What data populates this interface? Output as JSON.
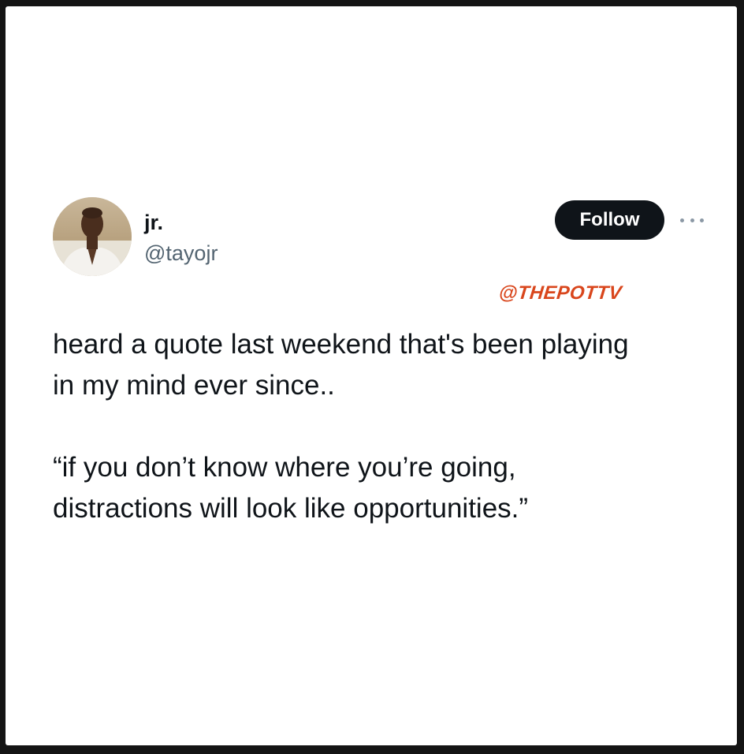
{
  "author": {
    "display_name": "jr.",
    "handle": "@tayojr",
    "avatar_icon": "profile-photo"
  },
  "actions": {
    "follow_label": "Follow",
    "more_icon": "more-horizontal-icon"
  },
  "watermark": {
    "text": "@THEPOTTV",
    "color": "#d9461c"
  },
  "tweet": {
    "paragraphs": [
      "heard a quote last weekend that's been playing\nin my mind ever since..",
      "“if you don’t know where you’re going,\ndistractions will look like opportunities.”"
    ]
  },
  "colors": {
    "frame": "#141414",
    "card": "#ffffff",
    "text_primary": "#0f1419",
    "text_secondary": "#536471",
    "button_bg": "#0f1419"
  }
}
